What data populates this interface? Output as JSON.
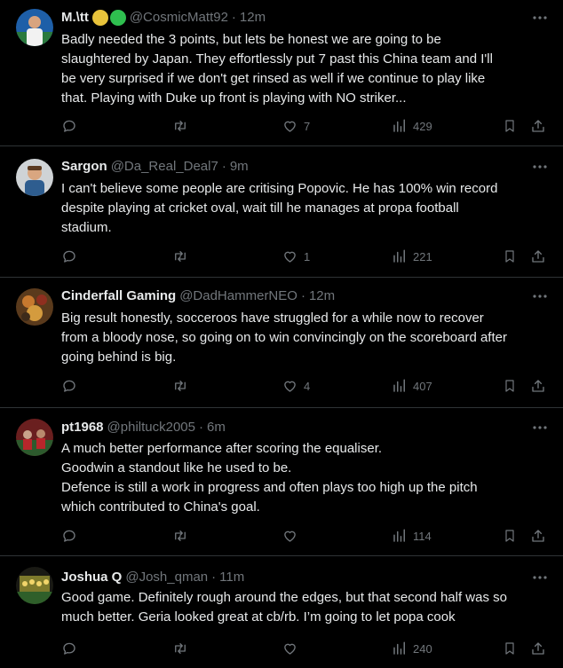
{
  "colors": {
    "background": "#000000",
    "text": "#e7e9ea",
    "secondary": "#71767b",
    "divider": "#2f3336",
    "badge_yellow": "#e8c33b",
    "badge_green": "#2fbf4f"
  },
  "tweets": [
    {
      "name": "M.\\tt",
      "badges": [
        "yellow-circle",
        "green-circle"
      ],
      "handle": "@CosmicMatt92",
      "sep": "·",
      "time": "12m",
      "lines": [
        "Badly needed the 3 points, but lets be honest we are going to be",
        "slaughtered by Japan. They effortlessly put 7 past this China team and I'll",
        "be very surprised if we don't get rinsed as well if we continue to play like",
        "that. Playing with Duke up front is playing with NO striker..."
      ],
      "likes": "7",
      "views": "429"
    },
    {
      "name": "Sargon",
      "handle": "@Da_Real_Deal7",
      "sep": "·",
      "time": "9m",
      "lines": [
        "I can't believe some people are critising Popovic. He has 100% win record",
        "despite playing at cricket oval, wait till he manages at propa football",
        "stadium."
      ],
      "likes": "1",
      "views": "221"
    },
    {
      "name": "Cinderfall Gaming",
      "handle": "@DadHammerNEO",
      "sep": "·",
      "time": "12m",
      "lines": [
        "Big result honestly, socceroos have struggled for a while now to recover",
        "from a bloody nose, so going on to win convincingly on the scoreboard after",
        "going behind is big."
      ],
      "likes": "4",
      "views": "407"
    },
    {
      "name": "pt1968",
      "handle": "@philtuck2005",
      "sep": "·",
      "time": "6m",
      "lines": [
        "A much better performance after scoring the equaliser.",
        "Goodwin a standout like he used to be.",
        "Defence is still a work in progress and often plays too high up the pitch",
        "which contributed to China's goal."
      ],
      "likes": "",
      "views": "114"
    },
    {
      "name": "Joshua Q",
      "handle": "@Josh_qman",
      "sep": "·",
      "time": "11m",
      "lines": [
        "Good game. Definitely rough around the edges, but that second half was so",
        "much better. Geria looked great at cb/rb. I’m going to let popa cook"
      ],
      "likes": "",
      "views": "240"
    }
  ]
}
